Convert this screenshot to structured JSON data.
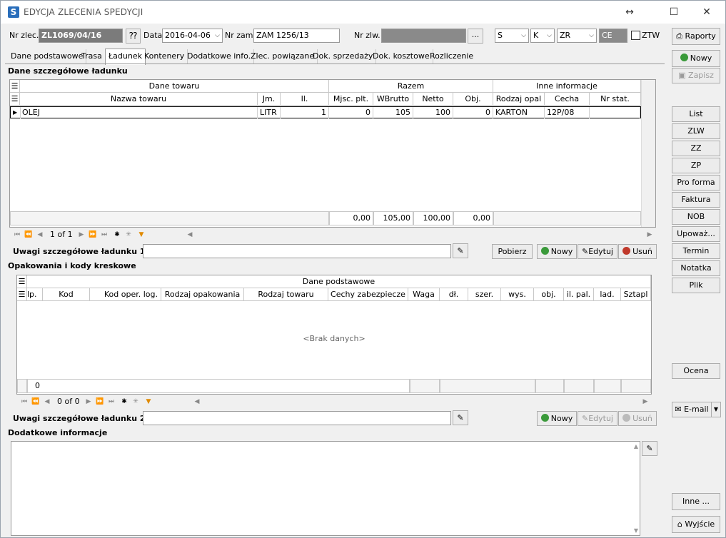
{
  "window": {
    "title": "EDYCJA ZLECENIA SPEDYCJI",
    "app_icon": "S"
  },
  "header": {
    "nr_zlec_label": "Nr zlec.",
    "nr_zlec_value": "ZL1069/04/16",
    "data_label": "Data",
    "data_value": "2016-04-06",
    "nr_zam_label": "Nr zam.",
    "nr_zam_value": "ZAM 1256/13",
    "nr_zlw_label": "Nr zlw.",
    "nr_zlw_value": "",
    "ellipsis_label": "...",
    "combo_s": "S",
    "combo_k": "K",
    "combo_zr": "ZR",
    "ce_value": "CE",
    "ztw_label": "ZTW"
  },
  "tabs": [
    {
      "label": "Dane podstawowe"
    },
    {
      "label": "Trasa"
    },
    {
      "label": "Ładunek"
    },
    {
      "label": "Kontenery"
    },
    {
      "label": "Dodatkowe info."
    },
    {
      "label": "Zlec. powiązane"
    },
    {
      "label": "Dok. sprzedaży"
    },
    {
      "label": "Dok. kosztowe"
    },
    {
      "label": "Rozliczenie"
    }
  ],
  "ladunek": {
    "section_title": "Dane szczegółowe ładunku",
    "group_headers": {
      "dane_towaru": "Dane towaru",
      "razem": "Razem",
      "inne": "Inne informacje"
    },
    "columns": [
      "Nazwa towaru",
      "Jm.",
      "Il.",
      "Mjsc. plt.",
      "WBrutto",
      "Netto",
      "Obj.",
      "Rodzaj opal",
      "Cecha",
      "Nr stat."
    ],
    "rows": [
      {
        "nazwa": "OLEJ",
        "jm": "LITR",
        "il": "1",
        "mjsc": "0",
        "wbrutto": "105",
        "netto": "100",
        "obj": "0",
        "rodzaj": "KARTON",
        "cecha": "12P/08",
        "nrstat": ""
      }
    ],
    "totals": {
      "mjsc": "0,00",
      "wbrutto": "105,00",
      "netto": "100,00",
      "obj": "0,00"
    },
    "nav_text": "1 of 1",
    "uwagi_label": "Uwagi szczegółowe ładunku 1",
    "uwagi_value": "",
    "btn_pobierz": "Pobierz",
    "btn_nowy": "Nowy",
    "btn_edytuj": "Edytuj",
    "btn_usun": "Usuń"
  },
  "opakowania": {
    "section_title": "Opakowania i kody kreskowe",
    "group_header": "Dane podstawowe",
    "columns": [
      "lp.",
      "Kod",
      "Kod oper. log.",
      "Rodzaj opakowania",
      "Rodzaj towaru",
      "Cechy zabezpiecze",
      "Waga",
      "dł.",
      "szer.",
      "wys.",
      "obj.",
      "il. pal.",
      "lad.",
      "Sztapl"
    ],
    "empty_text": "<Brak danych>",
    "footer_count": "0",
    "nav_text": "0 of 0",
    "uwagi_label": "Uwagi szczegółowe ładunku 2",
    "uwagi_value": "",
    "btn_nowy": "Nowy",
    "btn_edytuj": "Edytuj",
    "btn_usun": "Usuń"
  },
  "dodatkowe": {
    "section_title": "Dodatkowe informacje",
    "value": ""
  },
  "sidebar": {
    "raporty": "Raporty",
    "nowy": "Nowy",
    "zapisz": "Zapisz",
    "list": "List",
    "zlw": "ZLW",
    "zz": "ZZ",
    "zp": "ZP",
    "pro_forma": "Pro forma",
    "faktura": "Faktura",
    "nob": "NOB",
    "upowaz": "Upoważ...",
    "termin": "Termin",
    "notatka": "Notatka",
    "plik": "Plik",
    "ocena": "Ocena",
    "email": "E-mail",
    "inne": "Inne ...",
    "wyjscie": "Wyjście"
  },
  "colors": {
    "accent_green": "#3a9a3a",
    "delete_red": "#c0392b",
    "filter_orange": "#e08a00",
    "icon_blue": "#2a6ebb"
  }
}
